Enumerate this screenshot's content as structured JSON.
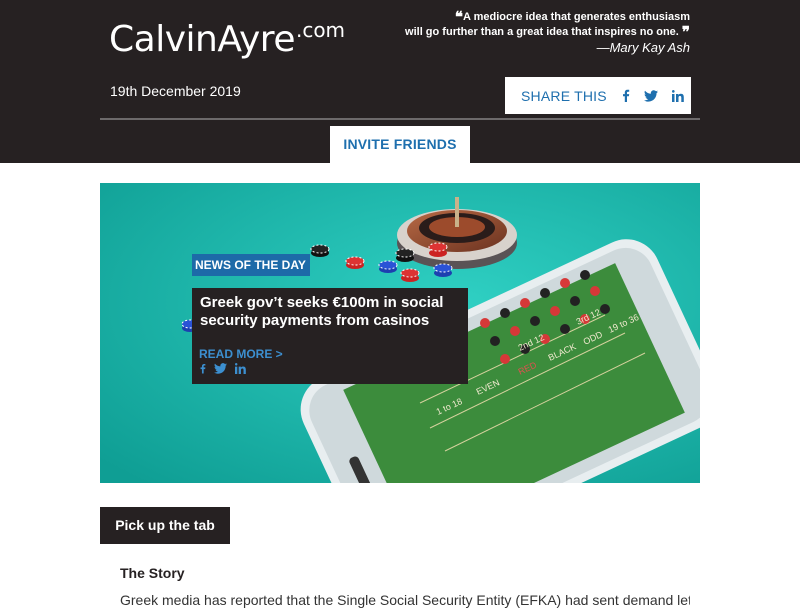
{
  "header": {
    "logo": {
      "main": "CalvinAyre",
      "suffix": ".com"
    },
    "quote": {
      "open_mark": "❝",
      "line1": "A mediocre idea that generates enthusiasm",
      "line2": "will go further than a great idea that inspires no one.",
      "close_mark": "❞",
      "author": "—Mary Kay Ash"
    },
    "date": "19th December 2019",
    "share_label": "SHARE THIS",
    "invite_label": "INVITE FRIENDS"
  },
  "hero": {
    "badge_prefix": "NEWS OF THE ",
    "badge_day": "DAY",
    "title": "Greek gov’t seeks €100m in social security payments from casinos",
    "read_more": "READ MORE >",
    "table_labels": [
      "1 to 18",
      "EVEN",
      "RED",
      "BLACK",
      "ODD",
      "19 to 36",
      "1st 12",
      "2nd 12",
      "3rd 12",
      "2 to 1"
    ]
  },
  "section": {
    "tab_label": "Pick up the tab",
    "story_heading": "The Story",
    "story_body": "Greek media has reported that the Single Social Security Entity (EFKA) had sent demand letters"
  },
  "colors": {
    "dark": "#262122",
    "link_blue": "#1e6fae",
    "hero_teal": "#18b8ad",
    "badge_blue": "#1d6aa8"
  },
  "icons": [
    "facebook-icon",
    "twitter-icon",
    "linkedin-icon"
  ]
}
